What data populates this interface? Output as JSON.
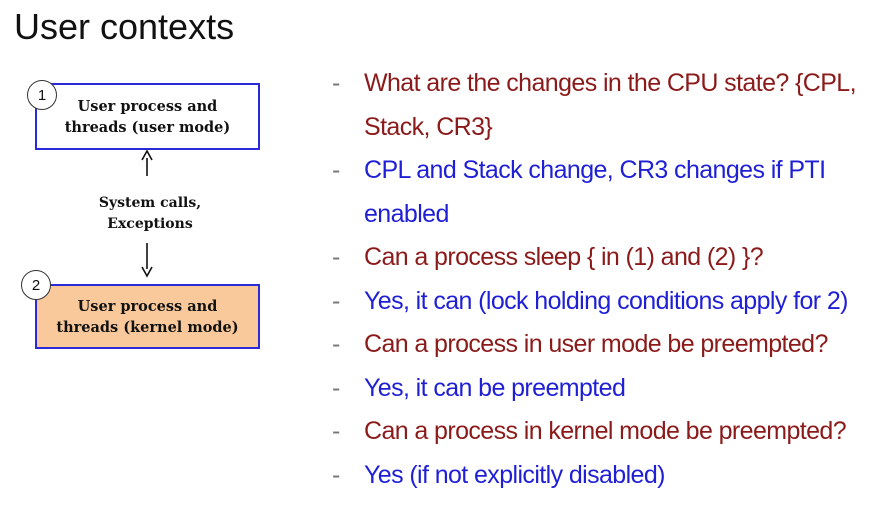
{
  "title": "User contexts",
  "diagram": {
    "user_box": {
      "number": "1",
      "line1": "User process and",
      "line2": "threads  (user mode)"
    },
    "kernel_box": {
      "number": "2",
      "line1": "User process and",
      "line2": "threads  (kernel mode)",
      "fill": "#f9c99b"
    },
    "transition_label": {
      "line1": "System calls,",
      "line2": "Exceptions"
    },
    "border_color": "#2a2ad8"
  },
  "bullets": [
    {
      "dash": "-",
      "kind": "question",
      "text": "What are the changes in the CPU state? {CPL, Stack, CR3}"
    },
    {
      "dash": "-",
      "kind": "answer",
      "text": "CPL and Stack change, CR3 changes if PTI enabled"
    },
    {
      "dash": "-",
      "kind": "question",
      "text": "Can a process sleep { in (1) and (2) }?"
    },
    {
      "dash": "-",
      "kind": "answer",
      "text": "Yes, it can (lock holding conditions apply for 2)"
    },
    {
      "dash": "-",
      "kind": "question",
      "text": "Can a process in user mode be preempted?"
    },
    {
      "dash": "-",
      "kind": "answer",
      "text": "Yes, it can be preempted"
    },
    {
      "dash": "-",
      "kind": "question",
      "text": "Can a process in kernel mode be preempted?"
    },
    {
      "dash": "-",
      "kind": "answer",
      "text": "Yes (if not explicitly disabled)"
    }
  ],
  "colors": {
    "question": "#8b1a1a",
    "answer": "#1f1fd6"
  }
}
